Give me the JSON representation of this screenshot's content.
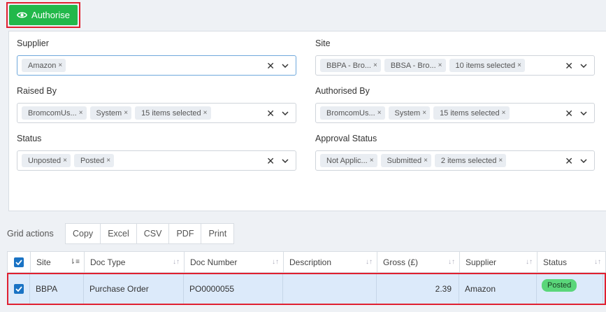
{
  "toolbar": {
    "authorise_label": "Authorise"
  },
  "filters": {
    "supplier": {
      "label": "Supplier",
      "chips": [
        "Amazon"
      ]
    },
    "site": {
      "label": "Site",
      "chips": [
        "BBPA - Bro...",
        "BBSA - Bro...",
        "10 items selected"
      ]
    },
    "raised_by": {
      "label": "Raised By",
      "chips": [
        "BromcomUs...",
        "System",
        "15 items selected"
      ]
    },
    "authorised_by": {
      "label": "Authorised By",
      "chips": [
        "BromcomUs...",
        "System",
        "15 items selected"
      ]
    },
    "status": {
      "label": "Status",
      "chips": [
        "Unposted",
        "Posted"
      ]
    },
    "approval_status": {
      "label": "Approval Status",
      "chips": [
        "Not Applic...",
        "Submitted",
        "2 items selected"
      ]
    },
    "chip_remove": "×",
    "clear": "✕"
  },
  "grid_actions": {
    "label": "Grid actions",
    "buttons": [
      "Copy",
      "Excel",
      "CSV",
      "PDF",
      "Print"
    ]
  },
  "grid": {
    "columns": [
      "Site",
      "Doc Type",
      "Doc Number",
      "Description",
      "Gross (£)",
      "Supplier",
      "Status"
    ],
    "rows": [
      {
        "site": "BBPA",
        "doc_type": "Purchase Order",
        "doc_number": "PO0000055",
        "description": "",
        "gross": "2.39",
        "supplier": "Amazon",
        "status": "Posted"
      }
    ]
  },
  "colors": {
    "authorise_bg": "#22b84a",
    "highlight": "#e02030",
    "checkbox": "#1a73c4",
    "status_posted": "#5ad67a"
  },
  "icons": {
    "authorise": "eye-icon",
    "clear": "close-icon",
    "expand": "chevron-down-icon",
    "sort": "sort-icon"
  }
}
